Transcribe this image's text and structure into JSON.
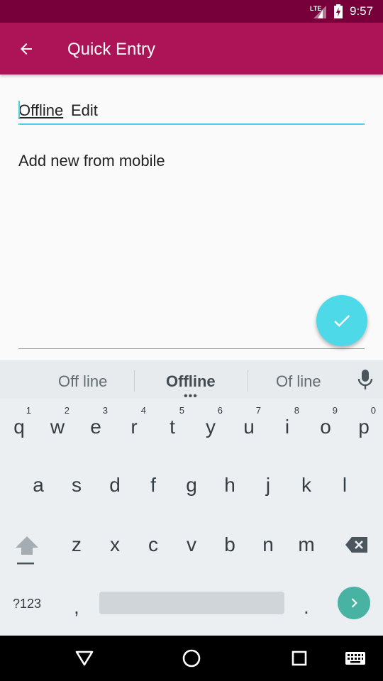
{
  "status_bar": {
    "network": "LTE",
    "time": "9:57"
  },
  "app_bar": {
    "title": "Quick Entry"
  },
  "form": {
    "title_word1": "Offline",
    "title_word2": "Edit",
    "body": "Add new from mobile"
  },
  "suggestions": [
    "Off line",
    "Offline",
    "Of line"
  ],
  "keyboard": {
    "row1": [
      {
        "key": "q",
        "num": "1"
      },
      {
        "key": "w",
        "num": "2"
      },
      {
        "key": "e",
        "num": "3"
      },
      {
        "key": "r",
        "num": "4"
      },
      {
        "key": "t",
        "num": "5"
      },
      {
        "key": "y",
        "num": "6"
      },
      {
        "key": "u",
        "num": "7"
      },
      {
        "key": "i",
        "num": "8"
      },
      {
        "key": "o",
        "num": "9"
      },
      {
        "key": "p",
        "num": "0"
      }
    ],
    "row2": [
      "a",
      "s",
      "d",
      "f",
      "g",
      "h",
      "j",
      "k",
      "l"
    ],
    "row3": [
      "z",
      "x",
      "c",
      "v",
      "b",
      "n",
      "m"
    ],
    "symbols_label": "?123",
    "comma": ",",
    "period": "."
  },
  "colors": {
    "status_bar": "#77003a",
    "app_bar": "#ad1457",
    "accent": "#4dd0e1",
    "enter": "#48b3a3"
  }
}
